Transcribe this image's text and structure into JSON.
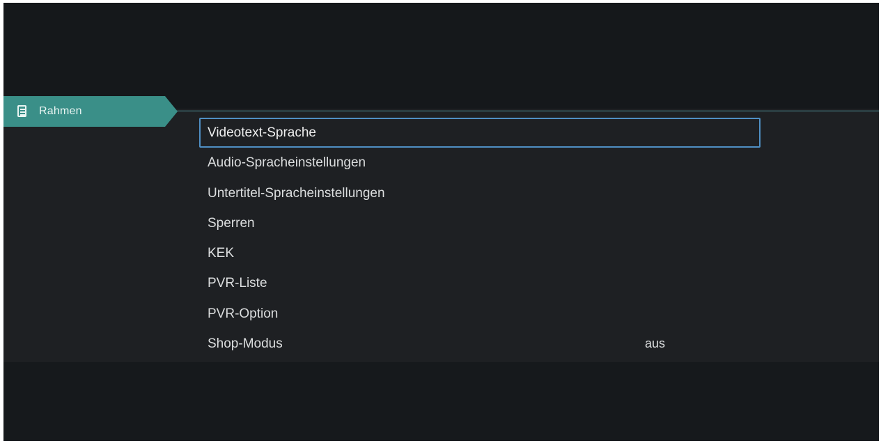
{
  "category_tab": {
    "label": "Rahmen",
    "icon": "document-list-icon",
    "accent_color": "#3a8f88"
  },
  "menu": {
    "items": [
      {
        "label": "Videotext-Sprache",
        "value": ""
      },
      {
        "label": "Audio-Spracheinstellungen",
        "value": ""
      },
      {
        "label": "Untertitel-Spracheinstellungen",
        "value": ""
      },
      {
        "label": "Sperren",
        "value": ""
      },
      {
        "label": "KEK",
        "value": ""
      },
      {
        "label": "PVR-Liste",
        "value": ""
      },
      {
        "label": "PVR-Option",
        "value": ""
      },
      {
        "label": "Shop-Modus",
        "value": "aus"
      }
    ],
    "selected_index": 0,
    "focus_color": "#4f8fc4"
  },
  "colors": {
    "background": "#16191c",
    "panel": "#1e2023",
    "text": "#dcdedf"
  }
}
